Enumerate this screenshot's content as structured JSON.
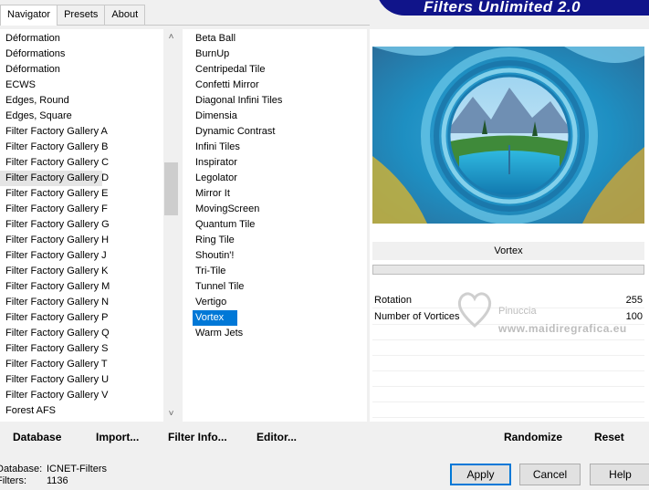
{
  "tabs": [
    {
      "label": "Navigator",
      "active": true
    },
    {
      "label": "Presets",
      "active": false
    },
    {
      "label": "About",
      "active": false
    }
  ],
  "banner": {
    "title": "Filters Unlimited 2.0"
  },
  "categories": [
    "Déformation",
    "Déformations",
    "Déformation",
    "ECWS",
    "Edges, Round",
    "Edges, Square",
    "Filter Factory Gallery A",
    "Filter Factory Gallery B",
    "Filter Factory Gallery C",
    "Filter Factory Gallery D",
    "Filter Factory Gallery E",
    "Filter Factory Gallery F",
    "Filter Factory Gallery G",
    "Filter Factory Gallery H",
    "Filter Factory Gallery J",
    "Filter Factory Gallery K",
    "Filter Factory Gallery M",
    "Filter Factory Gallery N",
    "Filter Factory Gallery P",
    "Filter Factory Gallery Q",
    "Filter Factory Gallery S",
    "Filter Factory Gallery T",
    "Filter Factory Gallery U",
    "Filter Factory Gallery V",
    "Forest AFS"
  ],
  "hover_category_index": 9,
  "filters": [
    "Beta Ball",
    "BurnUp",
    "Centripedal Tile",
    "Confetti Mirror",
    "Diagonal Infini Tiles",
    "Dimensia",
    "Dynamic Contrast",
    "Infini Tiles",
    "Inspirator",
    "Legolator",
    "Mirror It",
    "MovingScreen",
    "Quantum Tile",
    "Ring Tile",
    "Shoutin'!",
    "Tri-Tile",
    "Tunnel Tile",
    "Vertigo",
    "Vortex",
    "Warm Jets"
  ],
  "selected_filter_index": 18,
  "filter_name": "Vortex",
  "params": [
    {
      "name": "Rotation",
      "value": "255"
    },
    {
      "name": "Number of Vortices",
      "value": "100"
    }
  ],
  "watermark": {
    "line1": "Pinuccia",
    "line2": "www.maidiregrafica.eu"
  },
  "toolbar": {
    "database": "Database",
    "import": "Import...",
    "filter_info": "Filter Info...",
    "editor": "Editor...",
    "randomize": "Randomize",
    "reset": "Reset"
  },
  "info": {
    "database_label": "Database:",
    "database_value": "ICNET-Filters",
    "filters_label": "Filters:",
    "filters_value": "1136"
  },
  "buttons": {
    "apply": "Apply",
    "cancel": "Cancel",
    "help": "Help"
  },
  "colors": {
    "banner": "#10148a",
    "selection": "#0078d7"
  }
}
